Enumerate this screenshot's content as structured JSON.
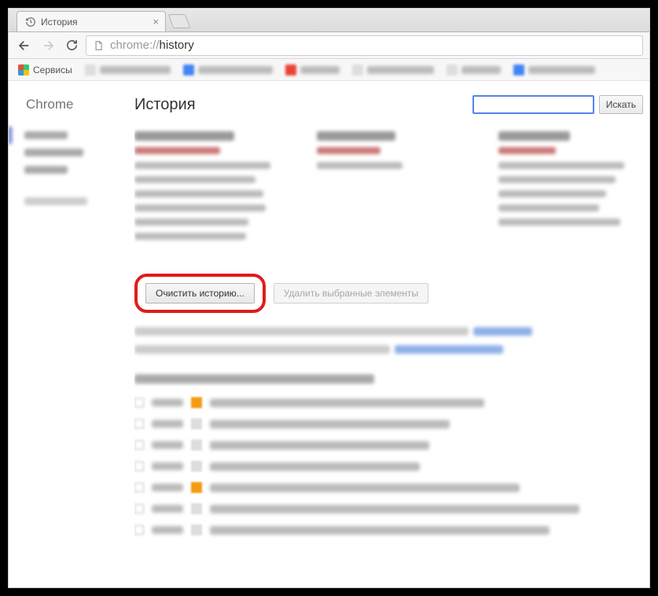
{
  "tab": {
    "title": "История",
    "close": "×"
  },
  "omnibox": {
    "scheme": "chrome://",
    "path": "history"
  },
  "bookmarks": {
    "services_label": "Сервисы"
  },
  "sidebar": {
    "brand": "Chrome"
  },
  "page": {
    "title": "История",
    "search_button": "Искать"
  },
  "actions": {
    "clear_history": "Очистить историю...",
    "delete_selected": "Удалить выбранные элементы"
  }
}
